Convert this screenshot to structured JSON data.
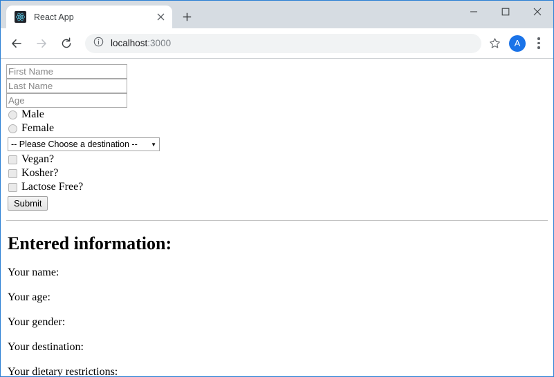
{
  "browser": {
    "tab": {
      "title": "React App",
      "favicon_icon": "react-logo-icon",
      "close_icon": "close-icon"
    },
    "new_tab_icon": "plus-icon",
    "window_controls": {
      "minimize_icon": "minimize-icon",
      "maximize_icon": "maximize-icon",
      "close_icon": "close-icon"
    },
    "toolbar": {
      "back_icon": "back-arrow-icon",
      "forward_icon": "forward-arrow-icon",
      "reload_icon": "reload-icon",
      "site_info_icon": "info-circle-icon",
      "url_host": "localhost",
      "url_port": ":3000",
      "bookmark_icon": "star-icon",
      "profile_initial": "A",
      "menu_icon": "three-dots-icon"
    },
    "colors": {
      "window_border": "#2a7fd4",
      "tabstrip_bg": "#d6dce2",
      "omnibox_bg": "#f1f3f4",
      "avatar_bg": "#1a73e8"
    }
  },
  "form": {
    "first_name": {
      "placeholder": "First Name",
      "value": ""
    },
    "last_name": {
      "placeholder": "Last Name",
      "value": ""
    },
    "age": {
      "placeholder": "Age",
      "value": ""
    },
    "gender_options": [
      {
        "label": "Male",
        "checked": false
      },
      {
        "label": "Female",
        "checked": false
      }
    ],
    "destination": {
      "selected": "-- Please Choose a destination --",
      "arrow_icon": "chevron-down-icon"
    },
    "dietary_options": [
      {
        "label": "Vegan?",
        "checked": false
      },
      {
        "label": "Kosher?",
        "checked": false
      },
      {
        "label": "Lactose Free?",
        "checked": false
      }
    ],
    "submit_label": "Submit"
  },
  "results": {
    "heading": "Entered information:",
    "lines": [
      "Your name:",
      "Your age:",
      "Your gender:",
      "Your destination:",
      "Your dietary restrictions:"
    ]
  }
}
